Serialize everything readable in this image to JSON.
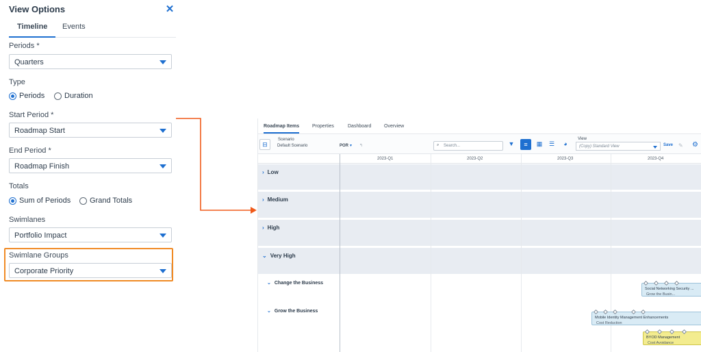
{
  "panel": {
    "title": "View Options",
    "tabs": [
      "Timeline",
      "Events"
    ],
    "periods": {
      "label": "Periods",
      "value": "Quarters"
    },
    "type": {
      "label": "Type",
      "options": [
        "Periods",
        "Duration"
      ],
      "selected": "Periods"
    },
    "start_period": {
      "label": "Start Period",
      "value": "Roadmap Start"
    },
    "end_period": {
      "label": "End Period",
      "value": "Roadmap Finish"
    },
    "totals": {
      "label": "Totals",
      "options": [
        "Sum of Periods",
        "Grand Totals"
      ],
      "selected": "Sum of Periods"
    },
    "swimlanes": {
      "label": "Swimlanes",
      "value": "Portfolio Impact"
    },
    "swimlane_groups": {
      "label": "Swimlane Groups",
      "value": "Corporate Priority"
    },
    "required_mark": "*",
    "close_icon": "close-icon"
  },
  "colors": {
    "accent": "#1e6fd0",
    "highlight": "#f08a24",
    "lane_bg": "#e8ecf2",
    "bar_blue": "#d9ebf5",
    "bar_yellow": "#f3ec8f"
  },
  "roadmap": {
    "tabs": [
      "Roadmap Items",
      "Properties",
      "Dashboard",
      "Overview"
    ],
    "scenario": {
      "label": "Scenario",
      "value": "Default Scenario",
      "badge": "POR"
    },
    "search_placeholder": "Search...",
    "view": {
      "label": "View",
      "value": "(Copy) Standard View"
    },
    "save_label": "Save",
    "quarters": [
      "2023-Q1",
      "2023-Q2",
      "2023-Q3",
      "2023-Q4"
    ],
    "lanes": [
      "Low",
      "Medium",
      "High",
      "Very High"
    ],
    "groups": [
      "Change the Business",
      "Grow the Business"
    ],
    "items": [
      {
        "title": "Social Networking Security ...",
        "sub": "Grow the Busin..."
      },
      {
        "title": "Mobile Identity Management Enhancements",
        "sub": "Cost Reduction"
      },
      {
        "title": "BYOD Management",
        "sub": "Cost Avoidance"
      }
    ]
  }
}
